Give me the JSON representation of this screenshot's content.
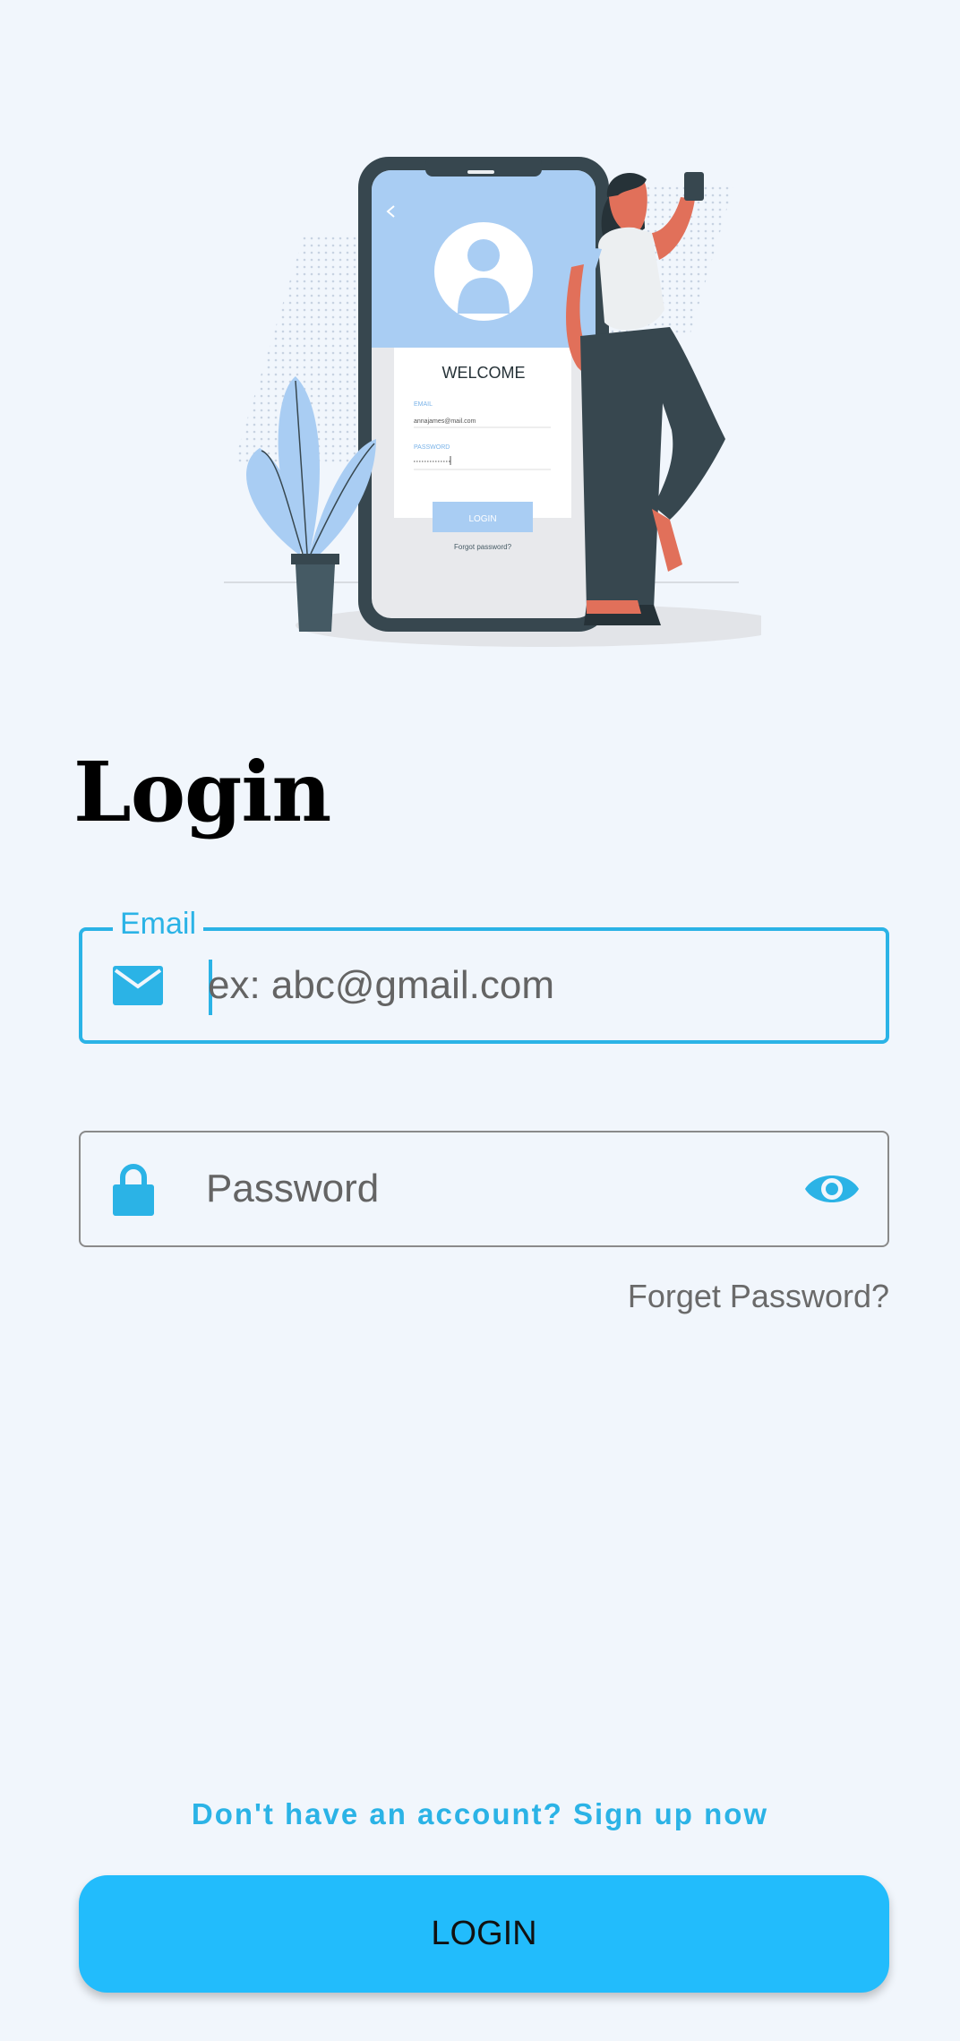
{
  "login": {
    "title": "Login",
    "email": {
      "label": "Email",
      "placeholder": "ex: abc@gmail.com",
      "value": "",
      "icon": "mail-icon"
    },
    "password": {
      "placeholder": "Password",
      "value": "",
      "icon": "lock-icon",
      "toggle_icon": "eye-icon"
    },
    "forgot_password": "Forget Password?",
    "signup_prompt": "Don't have an account? Sign up now",
    "submit_label": "LOGIN"
  },
  "illustration": {
    "name": "phone-login-illustration",
    "welcome": "WELCOME",
    "email_label": "EMAIL",
    "email_value": "annajames@mail.com",
    "password_label": "PASSWORD",
    "button_label": "LOGIN",
    "forgot_label": "Forgot password?"
  },
  "colors": {
    "accent": "#2bb3e6",
    "button": "#22bcfc",
    "background": "#f1f6fc"
  }
}
